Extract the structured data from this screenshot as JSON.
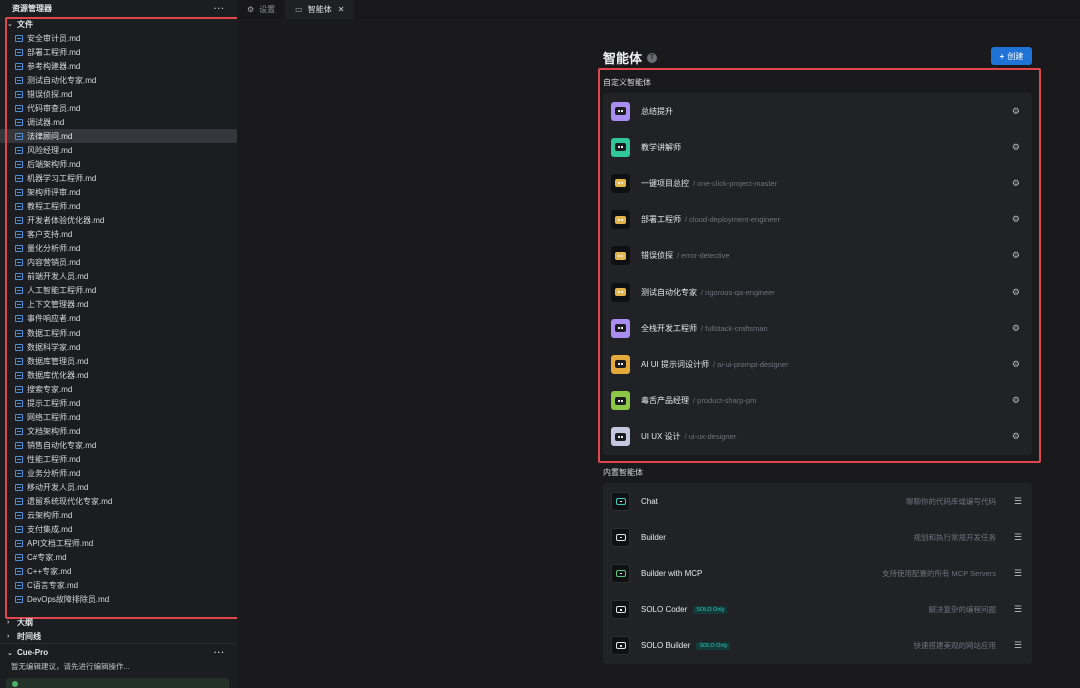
{
  "explorer": {
    "title": "资源管理器",
    "more": "···",
    "section": "文件",
    "files": [
      "安全审计员.md",
      "部署工程师.md",
      "参考构建器.md",
      "测试自动化专家.md",
      "错误侦探.md",
      "代码审查员.md",
      "调试器.md",
      "法律顾问.md",
      "风险经理.md",
      "后端架构师.md",
      "机器学习工程师.md",
      "架构师评审.md",
      "教程工程师.md",
      "开发者体验优化器.md",
      "客户支持.md",
      "量化分析师.md",
      "内容营销员.md",
      "前端开发人员.md",
      "人工智能工程师.md",
      "上下文管理器.md",
      "事件响应者.md",
      "数据工程师.md",
      "数据科学家.md",
      "数据库管理员.md",
      "数据库优化器.md",
      "搜索专家.md",
      "提示工程师.md",
      "网络工程师.md",
      "文档架构师.md",
      "销售自动化专家.md",
      "性能工程师.md",
      "业务分析师.md",
      "移动开发人员.md",
      "遗留系统现代化专家.md",
      "云架构师.md",
      "支付集成.md",
      "API文档工程师.md",
      "C#专家.md",
      "C++专家.md",
      "C语言专家.md",
      "DevOps故障排除员.md"
    ],
    "selected_index": 7,
    "outline": "大纲",
    "timeline": "时间线",
    "cue_title": "Cue-Pro",
    "cue_more": "···",
    "cue_message": "暂无编辑建议，请先进行编辑操作..."
  },
  "tabs": [
    {
      "label": "设置",
      "icon": "gear-icon"
    },
    {
      "label": "智能体",
      "icon": "robot-icon"
    }
  ],
  "main": {
    "title": "智能体",
    "help": "?",
    "create_label": "创建",
    "custom_label": "自定义智能体",
    "builtin_label": "内置智能体",
    "custom_agents": [
      {
        "name": "总结提升",
        "slug": "",
        "color": "#a98df2"
      },
      {
        "name": "教学讲解师",
        "slug": "",
        "color": "#2fc79b"
      },
      {
        "name": "一键项目总控",
        "slug": "/ one-click-project-master",
        "color": "#0f1012"
      },
      {
        "name": "部署工程师",
        "slug": "/ cloud-deployment-engineer",
        "color": "#0f1012"
      },
      {
        "name": "错误侦探",
        "slug": "/ error-detective",
        "color": "#0f1012"
      },
      {
        "name": "测试自动化专家",
        "slug": "/ rigorous-qa-engineer",
        "color": "#0f1012"
      },
      {
        "name": "全栈开发工程师",
        "slug": "/ fullstack-craftsman",
        "color": "#a98df2"
      },
      {
        "name": "AI UI 提示词设计师",
        "slug": "/ ai-ui-prompt-designer",
        "color": "#e3a93a"
      },
      {
        "name": "毒舌产品经理",
        "slug": "/ product-sharp-pm",
        "color": "#8cc748"
      },
      {
        "name": "UI UX 设计",
        "slug": "/ ui-ux-designer",
        "color": "#c3c8de"
      }
    ],
    "builtin_agents": [
      {
        "name": "Chat",
        "desc": "聊聊你的代码库或编写代码",
        "badge": ""
      },
      {
        "name": "Builder",
        "desc": "规划和执行常规开发任务",
        "badge": ""
      },
      {
        "name": "Builder with MCP",
        "desc": "支持使用配置的所有 MCP Servers",
        "badge": ""
      },
      {
        "name": "SOLO Coder",
        "desc": "解决复杂的编程问题",
        "badge": "SOLO Only"
      },
      {
        "name": "SOLO Builder",
        "desc": "快速搭建美观的网站应用",
        "badge": "SOLO Only"
      }
    ]
  }
}
